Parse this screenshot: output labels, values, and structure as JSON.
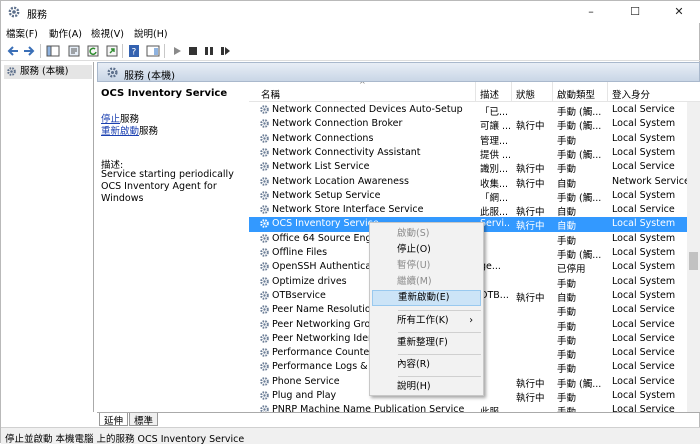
{
  "window": {
    "title": "服務",
    "min_glyph": "–",
    "max_glyph": "☐",
    "close_glyph": "✕"
  },
  "menu": {
    "file": "檔案(F)",
    "action": "動作(A)",
    "view": "檢視(V)",
    "help": "說明(H)"
  },
  "tree": {
    "item": "服務 (本機)"
  },
  "panel": {
    "header": "服務 (本機)",
    "service_name": "OCS Inventory Service",
    "stop_link": "停止",
    "stop_suffix": "服務",
    "restart_link": "重新啟動",
    "restart_suffix": "服務",
    "desc_label": "描述:",
    "desc_text": "Service starting periodically OCS Inventory Agent for Windows"
  },
  "columns": {
    "name": "名稱",
    "desc": "描述",
    "status": "狀態",
    "startup": "啟動類型",
    "logon": "登入身分"
  },
  "rows": [
    {
      "name": "Network Connected Devices Auto-Setup",
      "desc": "「已...",
      "status": "",
      "startup": "手動 (觸...",
      "logon": "Local Service"
    },
    {
      "name": "Network Connection Broker",
      "desc": "可讓 ...",
      "status": "執行中",
      "startup": "手動 (觸...",
      "logon": "Local System"
    },
    {
      "name": "Network Connections",
      "desc": "管理...",
      "status": "",
      "startup": "手動",
      "logon": "Local System"
    },
    {
      "name": "Network Connectivity Assistant",
      "desc": "提供 ...",
      "status": "",
      "startup": "手動 (觸...",
      "logon": "Local System"
    },
    {
      "name": "Network List Service",
      "desc": "識別...",
      "status": "執行中",
      "startup": "手動",
      "logon": "Local Service"
    },
    {
      "name": "Network Location Awareness",
      "desc": "收集...",
      "status": "執行中",
      "startup": "自動",
      "logon": "Network Service"
    },
    {
      "name": "Network Setup Service",
      "desc": "「網...",
      "status": "",
      "startup": "手動 (觸...",
      "logon": "Local System"
    },
    {
      "name": "Network Store Interface Service",
      "desc": "此服...",
      "status": "執行中",
      "startup": "自動",
      "logon": "Local Service"
    },
    {
      "name": "OCS Inventory Service",
      "desc": "Servi...",
      "status": "執行中",
      "startup": "自動",
      "logon": "Local System",
      "selected": true
    },
    {
      "name": "Office 64 Source Engine",
      "desc": "",
      "status": "",
      "startup": "手動",
      "logon": "Local System"
    },
    {
      "name": "Offline Files",
      "desc": "",
      "status": "",
      "startup": "手動 (觸...",
      "logon": "Local System"
    },
    {
      "name": "OpenSSH Authentication",
      "desc": "ge...",
      "status": "",
      "startup": "已停用",
      "logon": "Local System"
    },
    {
      "name": "Optimize drives",
      "desc": "",
      "status": "",
      "startup": "手動",
      "logon": "Local System"
    },
    {
      "name": "OTBservice",
      "desc": "OTB...",
      "status": "執行中",
      "startup": "自動",
      "logon": "Local System"
    },
    {
      "name": "Peer Name Resolution",
      "desc": "",
      "status": "",
      "startup": "手動",
      "logon": "Local Service"
    },
    {
      "name": "Peer Networking Group",
      "desc": "",
      "status": "",
      "startup": "手動",
      "logon": "Local Service"
    },
    {
      "name": "Peer Networking Identi",
      "desc": "",
      "status": "",
      "startup": "手動",
      "logon": "Local Service"
    },
    {
      "name": "Performance Counter D",
      "desc": "",
      "status": "",
      "startup": "手動",
      "logon": "Local Service"
    },
    {
      "name": "Performance Logs & Al",
      "desc": "",
      "status": "",
      "startup": "手動",
      "logon": "Local Service"
    },
    {
      "name": "Phone Service",
      "desc": "",
      "status": "執行中",
      "startup": "手動 (觸...",
      "logon": "Local Service"
    },
    {
      "name": "Plug and Play",
      "desc": "",
      "status": "執行中",
      "startup": "手動",
      "logon": "Local System"
    },
    {
      "name": "PNRP Machine Name Publication Service",
      "desc": "此服...",
      "status": "",
      "startup": "手動",
      "logon": "Local Service"
    }
  ],
  "context_menu": {
    "start": "啟動(S)",
    "stop": "停止(O)",
    "pause": "暫停(U)",
    "resume": "繼續(M)",
    "restart": "重新啟動(E)",
    "all_tasks": "所有工作(K)",
    "refresh": "重新整理(F)",
    "properties": "內容(R)",
    "help": "說明(H)",
    "submenu_arrow": "›"
  },
  "tabs": {
    "extended": "延伸",
    "standard": "標準"
  },
  "status": {
    "text": "停止並啟動 本機電腦 上的服務 OCS Inventory Service"
  },
  "colors": {
    "selection": "#3399ff",
    "link": "#1a3fb0",
    "menu_highlight": "#cce4f7"
  }
}
